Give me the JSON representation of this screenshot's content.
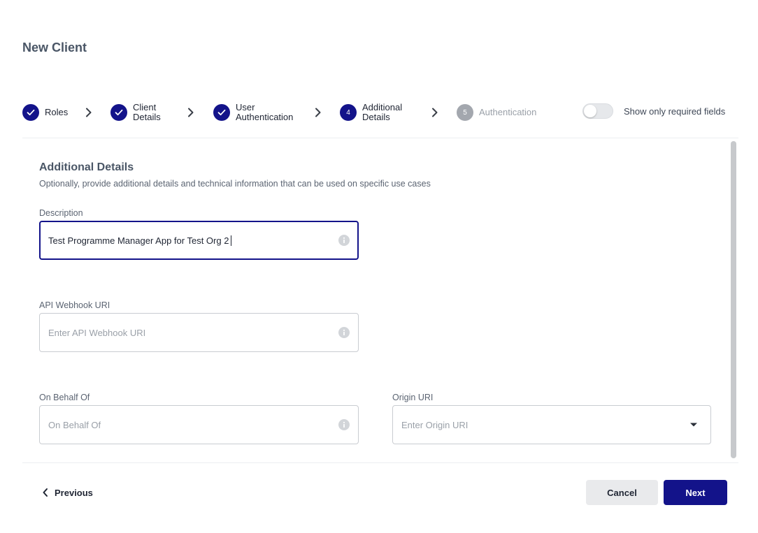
{
  "dialog": {
    "title": "New Client"
  },
  "stepper": {
    "steps": [
      {
        "label": "Roles",
        "state": "complete",
        "number": ""
      },
      {
        "label": "Client Details",
        "state": "complete",
        "number": ""
      },
      {
        "label": "User Authentication",
        "state": "complete",
        "number": ""
      },
      {
        "label": "Additional Details",
        "state": "current",
        "number": "4"
      },
      {
        "label": "Authentication",
        "state": "pending",
        "number": "5"
      }
    ]
  },
  "toggle": {
    "label": "Show only required fields",
    "on": false
  },
  "section": {
    "title": "Additional Details",
    "subtitle": "Optionally, provide additional details and technical information that can be used on specific use cases"
  },
  "fields": {
    "description": {
      "label": "Description",
      "value": "Test Programme Manager App for Test Org 2"
    },
    "api_webhook_uri": {
      "label": "API Webhook URI",
      "placeholder": "Enter API Webhook URI"
    },
    "on_behalf_of": {
      "label": "On Behalf Of",
      "placeholder": "On Behalf Of"
    },
    "origin_uri": {
      "label": "Origin URI",
      "placeholder": "Enter Origin URI"
    }
  },
  "footer": {
    "previous_label": "Previous",
    "cancel_label": "Cancel",
    "next_label": "Next"
  },
  "colors": {
    "primary": "#13138a",
    "pending": "#a3a7ae",
    "muted_text": "#9aa0a8"
  },
  "icons": {
    "step_complete": "check-icon",
    "step_separator": "chevron-right-icon",
    "field_info": "info-icon",
    "dropdown": "caret-down-icon",
    "previous": "chevron-left-icon"
  }
}
